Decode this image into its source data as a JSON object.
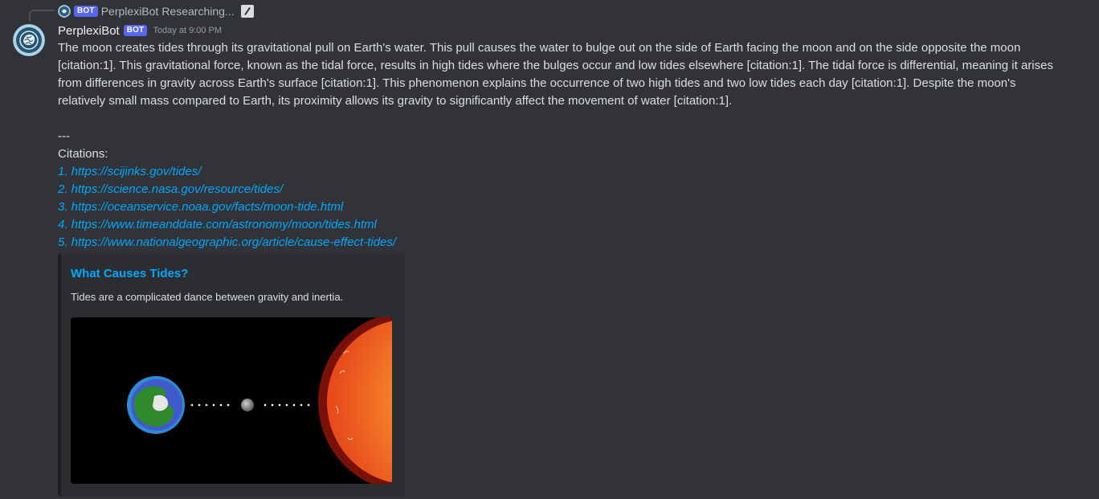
{
  "reply": {
    "username": "PerplexiBot",
    "bot_tag": "BOT",
    "text": "Researching..."
  },
  "message": {
    "username": "PerplexiBot",
    "bot_tag": "BOT",
    "timestamp": "Today at 9:00 PM",
    "body": "The moon creates tides through its gravitational pull on Earth's water. This pull causes the water to bulge out on the side of Earth facing the moon and on the side opposite the moon [citation:1]. This gravitational force, known as the tidal force, results in high tides where the bulges occur and low tides elsewhere [citation:1]. The tidal force is differential, meaning it arises from differences in gravity across Earth's surface [citation:1]. This phenomenon explains the occurrence of two high tides and two low tides each day [citation:1]. Despite the moon's relatively small mass compared to Earth, its proximity allows its gravity to significantly affect the movement of water [citation:1].",
    "separator": "---",
    "citations_heading": "Citations:",
    "citations": [
      "1. https://scijinks.gov/tides/",
      "2. https://science.nasa.gov/resource/tides/",
      "3. https://oceanservice.noaa.gov/facts/moon-tide.html",
      "4. https://www.timeanddate.com/astronomy/moon/tides.html",
      "5. https://www.nationalgeographic.org/article/cause-effect-tides/"
    ]
  },
  "embed": {
    "title": "What Causes Tides?",
    "description": "Tides are a complicated dance between gravity and inertia."
  },
  "icons": {
    "avatar": "brain-globe-icon",
    "command": "slash-command-icon"
  },
  "colors": {
    "background": "#313338",
    "link": "#00a8fc",
    "bot_tag": "#5865f2",
    "embed_bg": "#2b2d31"
  }
}
